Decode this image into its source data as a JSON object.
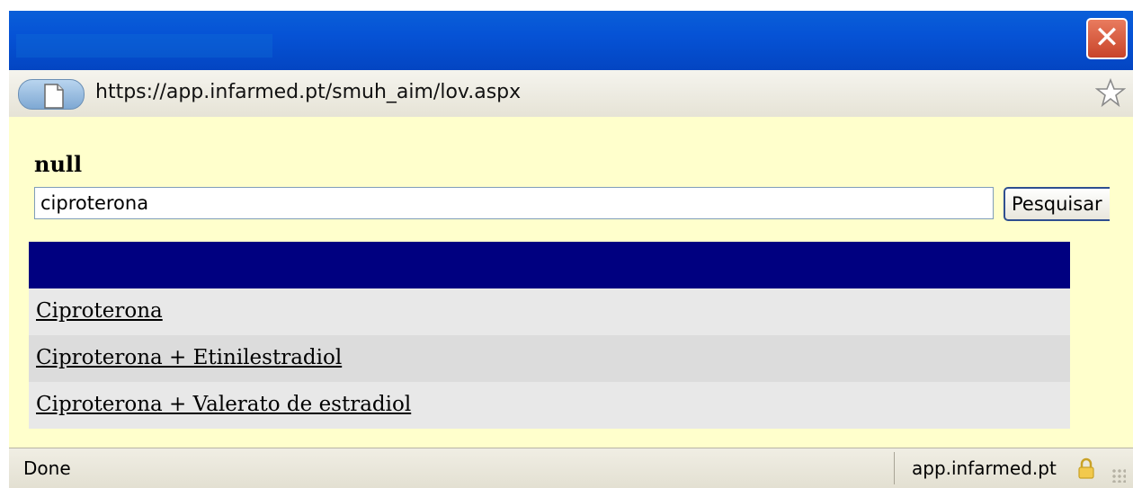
{
  "window": {
    "title": "",
    "close_symbol": "✕"
  },
  "address_bar": {
    "url": "https://app.infarmed.pt/smuh_aim/lov.aspx"
  },
  "form": {
    "heading": "null",
    "search_value": "ciproterona",
    "search_button_label": "Pesquisar"
  },
  "results": {
    "header_color": "#000080",
    "items": [
      {
        "label": "Ciproterona"
      },
      {
        "label": "Ciproterona + Etinilestradiol"
      },
      {
        "label": "Ciproterona + Valerato de estradiol"
      }
    ]
  },
  "status_bar": {
    "status_text": "Done",
    "domain": "app.infarmed.pt"
  },
  "colors": {
    "content_bg": "#ffffcc",
    "titlebar": "#0653d6",
    "close_button": "#d9583b"
  },
  "icons": [
    "close-icon",
    "page-icon",
    "bookmark-star-icon",
    "lock-icon",
    "resize-grip-icon"
  ]
}
